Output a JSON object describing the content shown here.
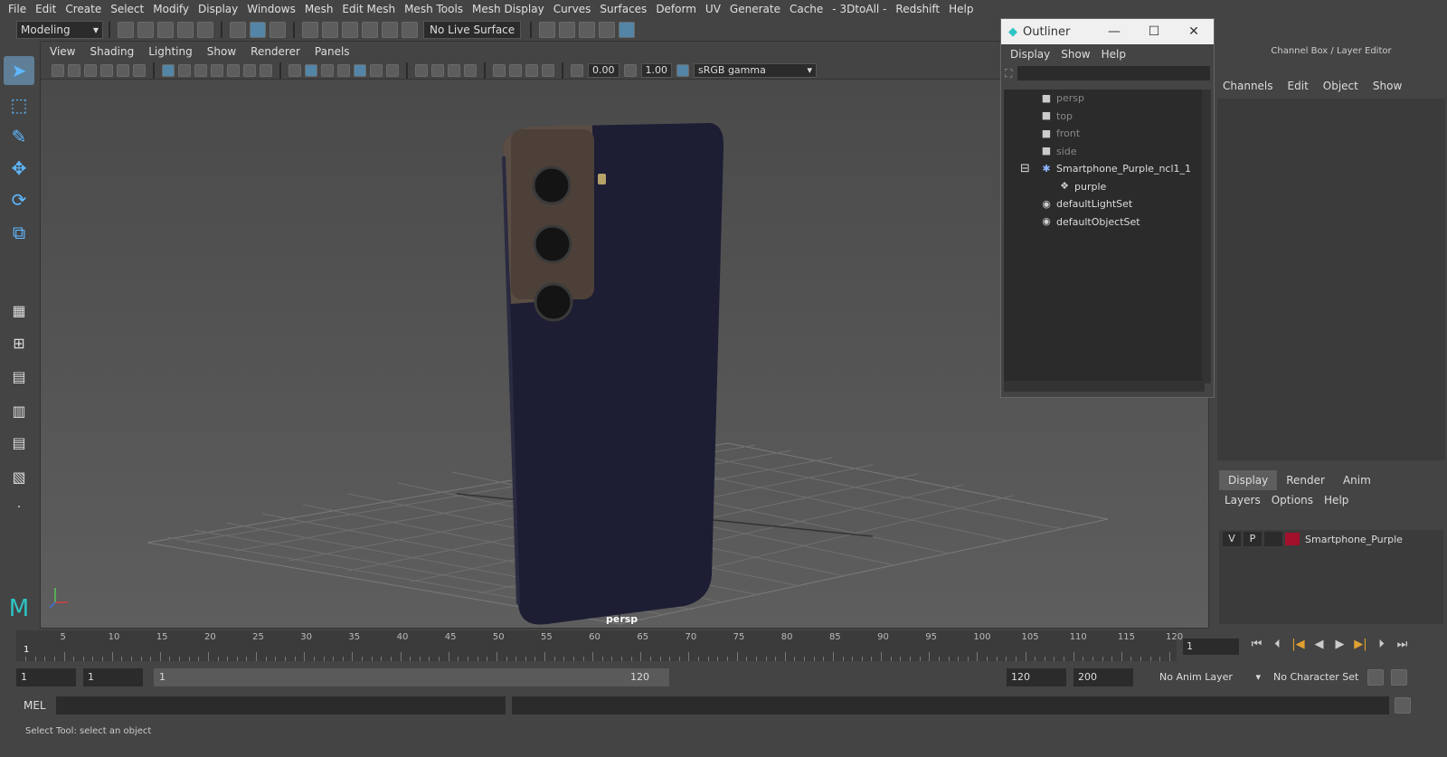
{
  "menubar": [
    "File",
    "Edit",
    "Create",
    "Select",
    "Modify",
    "Display",
    "Windows",
    "Mesh",
    "Edit Mesh",
    "Mesh Tools",
    "Mesh Display",
    "Curves",
    "Surfaces",
    "Deform",
    "UV",
    "Generate",
    "Cache",
    "- 3DtoAll -",
    "Redshift",
    "Help"
  ],
  "status": {
    "mode": "Modeling",
    "live_surface": "No Live Surface"
  },
  "viewport": {
    "menu": [
      "View",
      "Shading",
      "Lighting",
      "Show",
      "Renderer",
      "Panels"
    ],
    "exposure": "0.00",
    "gamma": "1.00",
    "colorspace": "sRGB gamma",
    "camera": "persp"
  },
  "outliner": {
    "title": "Outliner",
    "menu": [
      "Display",
      "Show",
      "Help"
    ],
    "items": [
      {
        "label": "persp",
        "icon": "camera-icon",
        "indent": 2,
        "dim": true
      },
      {
        "label": "top",
        "icon": "camera-icon",
        "indent": 2,
        "dim": true
      },
      {
        "label": "front",
        "icon": "camera-icon",
        "indent": 2,
        "dim": true
      },
      {
        "label": "side",
        "icon": "camera-icon",
        "indent": 2,
        "dim": true
      },
      {
        "label": "Smartphone_Purple_ncl1_1",
        "icon": "group-icon",
        "indent": 2,
        "dim": false,
        "expand": "minus"
      },
      {
        "label": "purple",
        "icon": "mesh-icon",
        "indent": 3,
        "dim": false
      },
      {
        "label": "defaultLightSet",
        "icon": "set-icon",
        "indent": 2,
        "dim": false
      },
      {
        "label": "defaultObjectSet",
        "icon": "set-icon",
        "indent": 2,
        "dim": false
      }
    ]
  },
  "channel_box": {
    "title": "Channel Box / Layer Editor",
    "menu": [
      "Channels",
      "Edit",
      "Object",
      "Show"
    ]
  },
  "layer_editor": {
    "tabs": [
      "Display",
      "Render",
      "Anim"
    ],
    "active_tab": "Display",
    "menu": [
      "Layers",
      "Options",
      "Help"
    ],
    "layers": [
      {
        "v": "V",
        "p": "P",
        "name": "Smartphone_Purple",
        "color": "#a3102c"
      }
    ]
  },
  "timeline": {
    "ticks": [
      "5",
      "10",
      "15",
      "20",
      "25",
      "30",
      "35",
      "40",
      "45",
      "50",
      "55",
      "60",
      "65",
      "70",
      "75",
      "80",
      "85",
      "90",
      "95",
      "100",
      "105",
      "110",
      "115",
      "120"
    ],
    "start_label": "1",
    "current_frame": "1"
  },
  "range": {
    "start": "1",
    "playback_start": "1",
    "slider_start": "1",
    "slider_end": "120",
    "playback_end": "120",
    "end": "200",
    "anim_layer": "No Anim Layer",
    "character_set": "No Character Set"
  },
  "mel": {
    "label": "MEL"
  },
  "help_line": "Select Tool: select an object"
}
